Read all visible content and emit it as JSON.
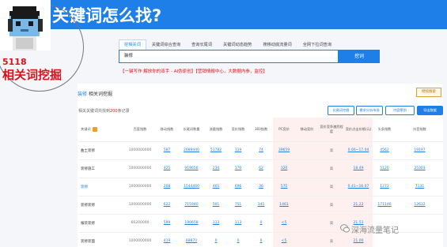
{
  "banner": {
    "title": "关键词怎么找?"
  },
  "caption": {
    "line1": "5118",
    "line2": "相关词挖掘"
  },
  "tabs": [
    "挖相关词",
    "关键词综合查询",
    "查询长尾词",
    "关键词动态趋势",
    "搜移动底流量词",
    "全网下拉词查询"
  ],
  "search": {
    "value": "装修",
    "button": "挖词"
  },
  "promo": "【一键写作 解放你的双手 - AI伪原创】【营销情报中心，大数据内参，监控】",
  "section": {
    "keyword": "装修",
    "title": "相关词挖掘",
    "more_button": "继续搜索"
  },
  "summary": {
    "prefix": "相关关键词共找到",
    "count": "200",
    "suffix": "条记录"
  },
  "actions": [
    "长尾词挖掘",
    "需求分析市场",
    "内容策划",
    "导出数据"
  ],
  "table": {
    "headers": [
      "关键词",
      "百度指数",
      "移动指数",
      "长尾词数量",
      "流量指数",
      "竞价指数",
      "360指数",
      "PC竞价",
      "移动竞价",
      "竞价竞争激烈程度",
      "竞价点击价格(元)",
      "头条指数",
      "抖音指数"
    ],
    "rows": [
      [
        "曲土装修",
        "1000000000",
        "587",
        "2689440",
        "51782",
        "119",
        "74",
        "39659",
        "高",
        "0.66~17.04",
        "4562",
        "19197"
      ],
      [
        "装修施工",
        "1000000000",
        "425",
        "919656",
        "234",
        "170",
        "62",
        "320",
        "高",
        "18.49",
        "5120",
        "25303"
      ],
      [
        "装修",
        "1000000000",
        "208",
        "1544460",
        "465",
        "696",
        "36",
        "575",
        "高",
        "0.41~16.07",
        "1272",
        "7131"
      ],
      [
        "装修装修",
        "1000000000",
        "622",
        "715940",
        "591",
        "751",
        "345",
        "1461",
        "高",
        "21.22",
        "171146",
        "12632"
      ],
      [
        "报装装修",
        "66200000",
        "599",
        "190658",
        "113",
        "113",
        "0",
        "<5",
        "高",
        "21.51",
        "",
        ""
      ],
      [
        "装修装面",
        "1000000000",
        "419",
        "68870",
        "0",
        "0",
        "0",
        "<5",
        "高",
        "21.00",
        "",
        ""
      ]
    ]
  },
  "watermark": "深海流量笔记",
  "colors": {
    "accent": "#1E7FE8",
    "danger": "#E0101A",
    "warning": "#f0a020"
  }
}
